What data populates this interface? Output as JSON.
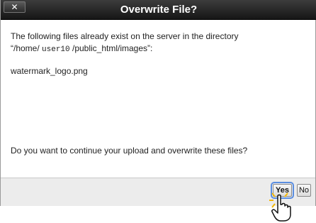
{
  "dialog": {
    "title": "Overwrite File?",
    "close_label": "✕",
    "message_line1": "The following files already exist on the server in the directory",
    "path_prefix": "“/home/",
    "path_user": "user10",
    "path_suffix": "/public_html/images”:",
    "file_name": "watermark_logo.png",
    "question": "Do you want to continue your upload and overwrite these files?",
    "yes_label": "Yes",
    "no_label": "No"
  },
  "colors": {
    "titlebar": "#1f1f1f",
    "focus_ring": "#5b8ee0",
    "footer": "#ececec"
  }
}
